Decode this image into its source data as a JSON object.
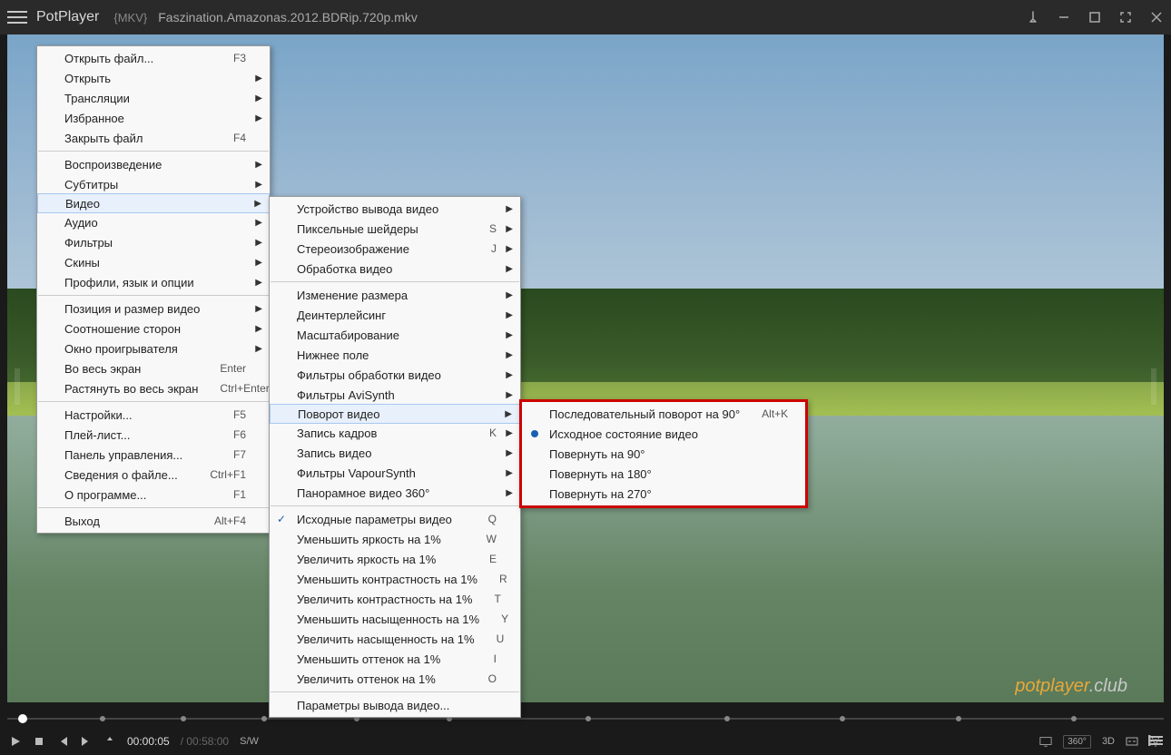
{
  "titlebar": {
    "app_name": "PotPlayer",
    "tag": "{MKV}",
    "file_name": "Faszination.Amazonas.2012.BDRip.720p.mkv"
  },
  "watermark": {
    "a": "potplayer",
    "b": ".club"
  },
  "ctrlbar": {
    "time_cur": "00:00:05",
    "time_dur": "/ 00:58:00",
    "hw": "S/W",
    "v360": "360°",
    "v3d": "3D"
  },
  "menu1": [
    {
      "label": "Открыть файл...",
      "shortcut": "F3"
    },
    {
      "label": "Открыть",
      "arrow": true
    },
    {
      "label": "Трансляции",
      "arrow": true
    },
    {
      "label": "Избранное",
      "arrow": true
    },
    {
      "label": "Закрыть файл",
      "shortcut": "F4"
    },
    {
      "sep": true
    },
    {
      "label": "Воспроизведение",
      "arrow": true
    },
    {
      "label": "Субтитры",
      "arrow": true
    },
    {
      "label": "Видео",
      "arrow": true,
      "hl": true
    },
    {
      "label": "Аудио",
      "arrow": true
    },
    {
      "label": "Фильтры",
      "arrow": true
    },
    {
      "label": "Скины",
      "arrow": true
    },
    {
      "label": "Профили, язык и опции",
      "arrow": true
    },
    {
      "sep": true
    },
    {
      "label": "Позиция и размер видео",
      "arrow": true
    },
    {
      "label": "Соотношение сторон",
      "arrow": true
    },
    {
      "label": "Окно проигрывателя",
      "arrow": true
    },
    {
      "label": "Во весь экран",
      "shortcut": "Enter"
    },
    {
      "label": "Растянуть во весь экран",
      "shortcut": "Ctrl+Enter"
    },
    {
      "sep": true
    },
    {
      "label": "Настройки...",
      "shortcut": "F5"
    },
    {
      "label": "Плей-лист...",
      "shortcut": "F6"
    },
    {
      "label": "Панель управления...",
      "shortcut": "F7"
    },
    {
      "label": "Сведения о файле...",
      "shortcut": "Ctrl+F1"
    },
    {
      "label": "О программе...",
      "shortcut": "F1"
    },
    {
      "sep": true
    },
    {
      "label": "Выход",
      "shortcut": "Alt+F4"
    }
  ],
  "menu2": [
    {
      "label": "Устройство вывода видео",
      "arrow": true
    },
    {
      "label": "Пиксельные шейдеры",
      "shortcut": "S",
      "arrow": true
    },
    {
      "label": "Стереоизображение",
      "shortcut": "J",
      "arrow": true
    },
    {
      "label": "Обработка видео",
      "arrow": true
    },
    {
      "sep": true
    },
    {
      "label": "Изменение размера",
      "arrow": true
    },
    {
      "label": "Деинтерлейсинг",
      "arrow": true
    },
    {
      "label": "Масштабирование",
      "arrow": true
    },
    {
      "label": "Нижнее поле",
      "arrow": true
    },
    {
      "label": "Фильтры обработки видео",
      "arrow": true
    },
    {
      "label": "Фильтры AviSynth",
      "arrow": true
    },
    {
      "label": "Поворот видео",
      "arrow": true,
      "hl": true
    },
    {
      "label": "Запись кадров",
      "shortcut": "K",
      "arrow": true
    },
    {
      "label": "Запись видео",
      "arrow": true
    },
    {
      "label": "Фильтры VapourSynth",
      "arrow": true
    },
    {
      "label": "Панорамное видео 360°",
      "arrow": true
    },
    {
      "sep": true
    },
    {
      "label": "Исходные параметры видео",
      "shortcut": "Q",
      "check": true
    },
    {
      "label": "Уменьшить яркость на 1%",
      "shortcut": "W"
    },
    {
      "label": "Увеличить яркость на 1%",
      "shortcut": "E"
    },
    {
      "label": "Уменьшить контрастность на 1%",
      "shortcut": "R"
    },
    {
      "label": "Увеличить контрастность на 1%",
      "shortcut": "T"
    },
    {
      "label": "Уменьшить насыщенность на 1%",
      "shortcut": "Y"
    },
    {
      "label": "Увеличить насыщенность на 1%",
      "shortcut": "U"
    },
    {
      "label": "Уменьшить оттенок на 1%",
      "shortcut": "I"
    },
    {
      "label": "Увеличить оттенок на 1%",
      "shortcut": "O"
    },
    {
      "sep": true
    },
    {
      "label": "Параметры вывода видео..."
    }
  ],
  "menu3": [
    {
      "label": "Последовательный поворот на 90°",
      "shortcut": "Alt+K"
    },
    {
      "label": "Исходное состояние видео",
      "radio": true
    },
    {
      "label": "Повернуть на 90°"
    },
    {
      "label": "Повернуть на 180°"
    },
    {
      "label": "Повернуть на 270°"
    }
  ]
}
